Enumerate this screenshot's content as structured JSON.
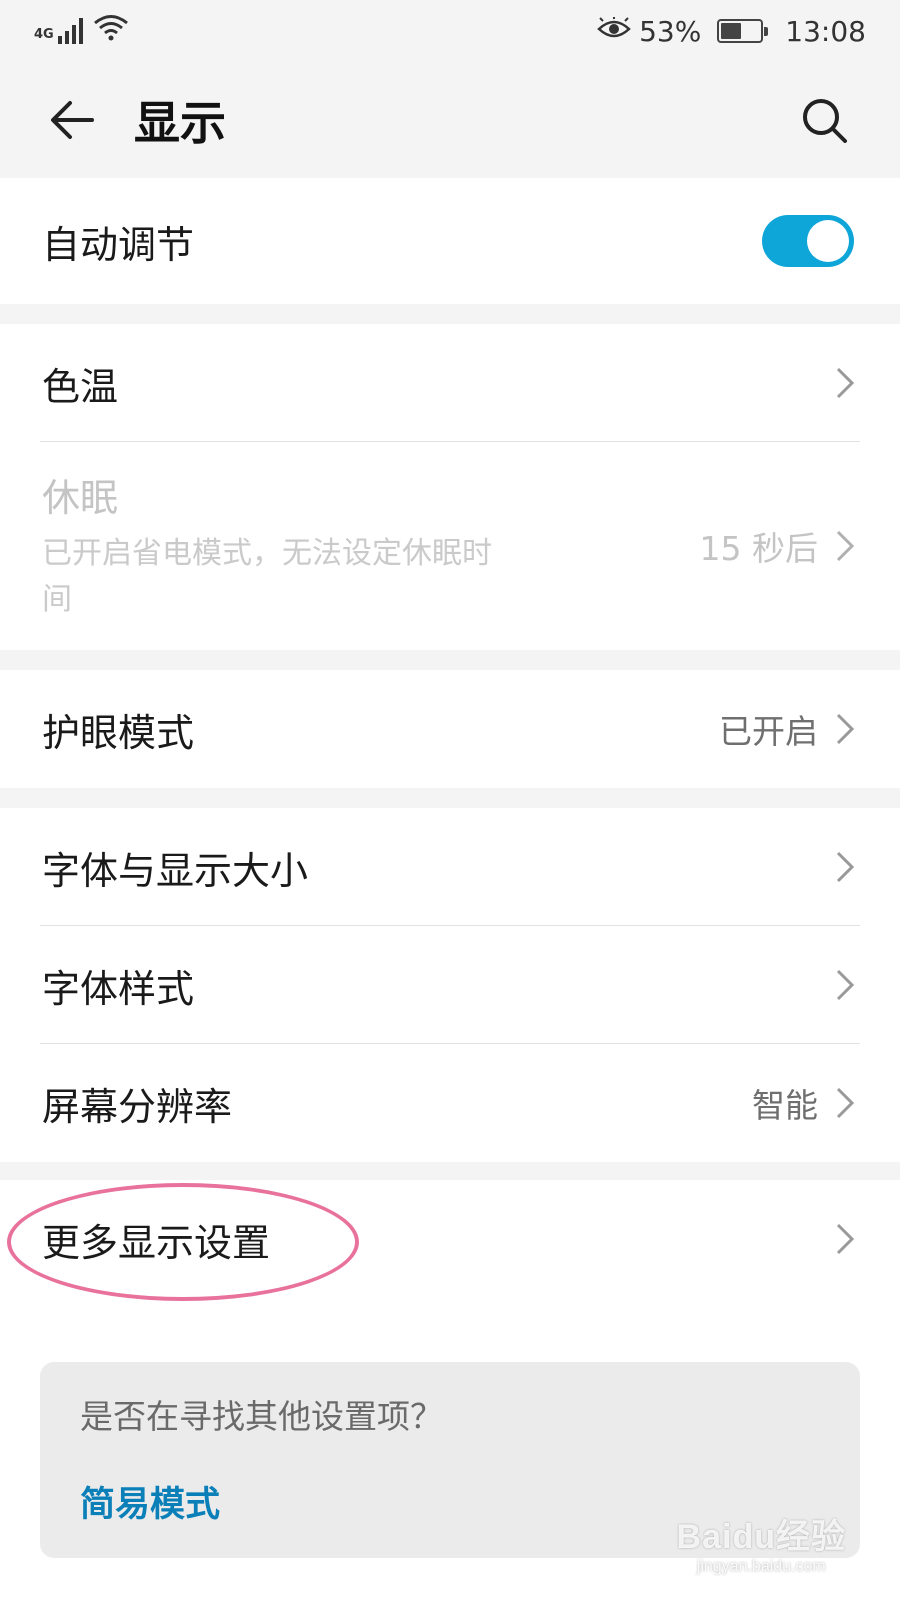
{
  "status_bar": {
    "network": "4G",
    "signal_icon": "cell-signal-icon",
    "wifi_icon": "wifi-icon",
    "eye_icon": "eye-comfort-icon",
    "battery_percent": "53%",
    "battery_level": 0.53,
    "time": "13:08"
  },
  "app_bar": {
    "title": "显示",
    "back_icon": "arrow-left-icon",
    "search_icon": "search-icon"
  },
  "settings": {
    "auto_adjust": {
      "label": "自动调节",
      "enabled": true
    },
    "color_temp": {
      "label": "色温"
    },
    "sleep": {
      "label": "休眠",
      "subtitle_line1": "已开启省电模式，无法设定休眠时",
      "subtitle_line2": "间",
      "value": "15 秒后"
    },
    "eye_comfort": {
      "label": "护眼模式",
      "value": "已开启"
    },
    "font_size": {
      "label": "字体与显示大小"
    },
    "font_style": {
      "label": "字体样式"
    },
    "resolution": {
      "label": "屏幕分辨率",
      "value": "智能"
    },
    "more_display": {
      "label": "更多显示设置"
    }
  },
  "hint": {
    "question": "是否在寻找其他设置项？",
    "link": "简易模式"
  },
  "watermark": {
    "main": "Baidu经验",
    "sub": "jingyan.baidu.com"
  },
  "colors": {
    "accent": "#0ea5d9",
    "link": "#0a7fb8",
    "highlight_circle": "#e8729b"
  }
}
